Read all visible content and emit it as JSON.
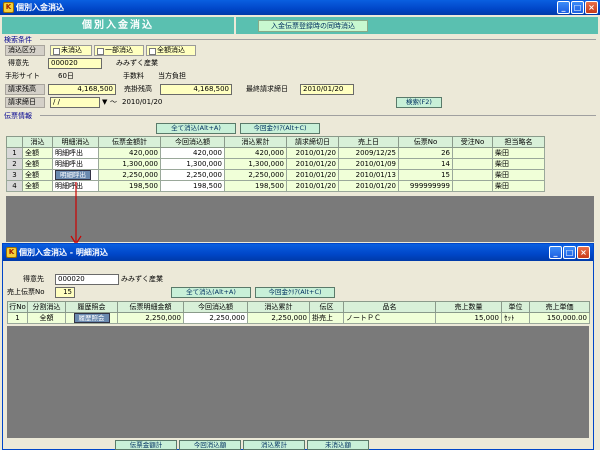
{
  "main_window": {
    "title": "個別入金消込",
    "header_title": "個別入金消込",
    "header_link": "入金伝票登録時の同時消込",
    "search_section": "検索条件",
    "kesikomi_kubun_label": "消込区分",
    "kesikomi_options": [
      "未消込",
      "一部消込",
      "全額消込"
    ],
    "customer_label": "得意先",
    "customer_code": "000020",
    "customer_name": "みみずく産業",
    "site_label": "手形サイト",
    "site_value": "60日",
    "fee_label": "手数料",
    "fee_value": "当方負担",
    "seikyu_zan_label": "請求残高",
    "seikyu_zan_value": "4,168,500",
    "urikake_zan_label": "売掛残高",
    "urikake_zan_value": "4,168,500",
    "last_bill_label": "最終請求締日",
    "last_bill_value": "2010/01/20",
    "bill_date_label": "請求締日",
    "bill_date_from": "/ /",
    "bill_date_to": "2010/01/20",
    "tilde": "〜",
    "search_button": "検索(F2)",
    "slip_section": "伝票情報",
    "all_clear_button": "全て消込(Alt+A)",
    "clear_current_button": "今回金ｸﾘｱ(Alt+C)",
    "columns": [
      "",
      "消込",
      "明細消込",
      "伝票金額計",
      "今回消込額",
      "消込累計",
      "請求締切日",
      "売上日",
      "伝票No",
      "受注No",
      "担当略名"
    ],
    "rows": [
      {
        "no": "1",
        "kesi": "全額",
        "detail": "明細呼出",
        "total": "420,000",
        "current": "420,000",
        "cumulative": "420,000",
        "closing": "2010/01/20",
        "sales_date": "2009/12/25",
        "slip_no": "26",
        "order_no": "",
        "staff": "柴田"
      },
      {
        "no": "2",
        "kesi": "全額",
        "detail": "明細呼出",
        "total": "1,300,000",
        "current": "1,300,000",
        "cumulative": "1,300,000",
        "closing": "2010/01/20",
        "sales_date": "2010/01/09",
        "slip_no": "14",
        "order_no": "",
        "staff": "柴田"
      },
      {
        "no": "3",
        "kesi": "全額",
        "detail": "明細呼出",
        "total": "2,250,000",
        "current": "2,250,000",
        "cumulative": "2,250,000",
        "closing": "2010/01/20",
        "sales_date": "2010/01/13",
        "slip_no": "15",
        "order_no": "",
        "staff": "柴田"
      },
      {
        "no": "4",
        "kesi": "全額",
        "detail": "明細呼出",
        "total": "198,500",
        "current": "198,500",
        "cumulative": "198,500",
        "closing": "2010/01/20",
        "sales_date": "2010/01/20",
        "slip_no": "999999999",
        "order_no": "",
        "staff": "柴田"
      }
    ]
  },
  "detail_window": {
    "title": "個別入金消込 - 明細消込",
    "customer_label": "得意先",
    "customer_code": "000020",
    "customer_name": "みみずく産業",
    "slip_no_label": "売上伝票No",
    "slip_no_value": "15",
    "all_clear_button": "全て消込(Alt+A)",
    "clear_current_button": "今回金ｸﾘｱ(Alt+C)",
    "columns": [
      "行No",
      "分割消込",
      "履歴照会",
      "伝票明細金額",
      "今回消込額",
      "消込累計",
      "伝区",
      "品名",
      "売上数量",
      "単位",
      "売上単価"
    ],
    "rows": [
      {
        "no": "1",
        "split": "全額",
        "history": "履歴照会",
        "amount": "2,250,000",
        "current": "2,250,000",
        "cumulative": "2,250,000",
        "kubun": "掛売上",
        "item": "ノートＰＣ",
        "qty": "15,000",
        "unit": "ｾｯﾄ",
        "price": "150,000.00"
      }
    ],
    "footer_labels": [
      "伝票金額計",
      "今回消込額",
      "消込累計",
      "未消込額"
    ]
  },
  "colors": {
    "title_blue": "#0046c8",
    "field_yellow": "#ffffc0",
    "grid_green": "#f0ffd8",
    "arrow_red": "#cc0000"
  }
}
